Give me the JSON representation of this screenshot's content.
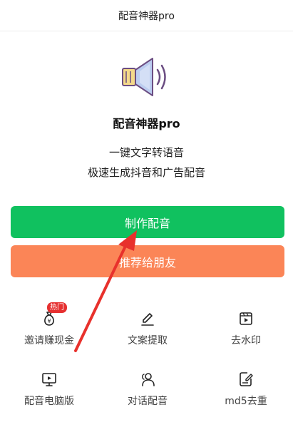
{
  "header": {
    "title": "配音神器pro"
  },
  "app": {
    "name": "配音神器pro",
    "slogan_line1": "一键文字转语音",
    "slogan_line2": "极速生成抖音和广告配音",
    "logo_icon": "speaker-icon"
  },
  "buttons": {
    "make": "制作配音",
    "share": "推荐给朋友"
  },
  "features": [
    {
      "label": "邀请赚现金",
      "icon": "money-bag-icon",
      "badge": "热门"
    },
    {
      "label": "文案提取",
      "icon": "pen-icon"
    },
    {
      "label": "去水印",
      "icon": "video-icon"
    },
    {
      "label": "配音电脑版",
      "icon": "monitor-icon"
    },
    {
      "label": "对话配音",
      "icon": "users-icon"
    },
    {
      "label": "md5去重",
      "icon": "document-edit-icon"
    }
  ],
  "colors": {
    "primary": "#10c15f",
    "secondary": "#fb8557",
    "badge": "#e63030",
    "arrow": "#e8312c"
  }
}
